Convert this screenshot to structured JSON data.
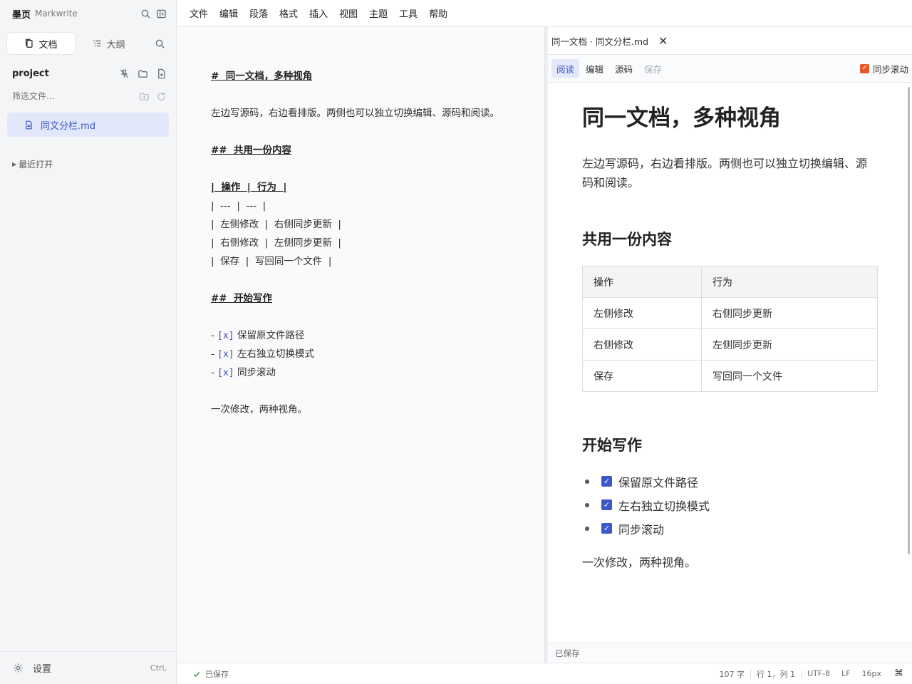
{
  "app": {
    "name": "墨页",
    "subtitle": "Markwrite"
  },
  "sidebar": {
    "tabs": [
      {
        "label": "文档"
      },
      {
        "label": "大纲"
      }
    ],
    "project": "project",
    "filter_placeholder": "筛选文件…",
    "files": [
      {
        "name": "同文分栏.md"
      }
    ],
    "recent_label": "最近打开",
    "settings_label": "设置",
    "settings_shortcut": "Ctrl,"
  },
  "menu": [
    "文件",
    "编辑",
    "段落",
    "格式",
    "插入",
    "视图",
    "主题",
    "工具",
    "帮助"
  ],
  "editor": {
    "lines": [
      {
        "text": "#  同一文档，多种视角",
        "heading": true
      },
      {
        "text": ""
      },
      {
        "text": "左边写源码，右边看排版。两侧也可以独立切换编辑、源码和阅读。"
      },
      {
        "text": ""
      },
      {
        "text": "##  共用一份内容",
        "heading": true
      },
      {
        "text": ""
      },
      {
        "text": "|  操作  |  行为  |",
        "heading": true
      },
      {
        "text": "|  ---  |  ---  |"
      },
      {
        "text": "|  左侧修改  |  右侧同步更新  |"
      },
      {
        "text": "|  右侧修改  |  左侧同步更新  |"
      },
      {
        "text": "|  保存  |  写回同一个文件  |"
      },
      {
        "text": ""
      },
      {
        "text": "##  开始写作",
        "heading": true
      },
      {
        "text": ""
      },
      {
        "text": "保留原文件路径",
        "task": true
      },
      {
        "text": "左右独立切换模式",
        "task": true
      },
      {
        "text": "同步滚动",
        "task": true
      },
      {
        "text": ""
      },
      {
        "text": "一次修改，两种视角。"
      }
    ],
    "task_prefix": "- ",
    "task_marker": "[x]"
  },
  "preview": {
    "title": "同一文档 · 同文分栏.md",
    "close_glyph": "✕",
    "modes": [
      {
        "label": "阅读",
        "state": "active"
      },
      {
        "label": "编辑",
        "state": "normal"
      },
      {
        "label": "源码",
        "state": "normal"
      },
      {
        "label": "保存",
        "state": "disabled"
      }
    ],
    "sync_label": "同步滚动",
    "h1": "同一文档，多种视角",
    "intro": "左边写源码，右边看排版。两侧也可以独立切换编辑、源码和阅读。",
    "h2_shared": "共用一份内容",
    "table": {
      "headers": [
        "操作",
        "行为"
      ],
      "rows": [
        [
          "左侧修改",
          "右侧同步更新"
        ],
        [
          "右侧修改",
          "左侧同步更新"
        ],
        [
          "保存",
          "写回同一个文件"
        ]
      ]
    },
    "h2_start": "开始写作",
    "tasks": [
      "保留原文件路径",
      "左右独立切换模式",
      "同步滚动"
    ],
    "closing": "一次修改，两种视角。",
    "status": "已保存"
  },
  "statusbar": {
    "saved": "已保存",
    "word_count": "107 字",
    "position": "行 1，列 1",
    "encoding": "UTF-8",
    "line_ending": "LF",
    "font_size": "16px",
    "cmd_glyph": "⌘"
  },
  "colors": {
    "accent": "#3b57c8",
    "sync_checkbox": "#e8572a",
    "sidebar_bg": "#f4f5f7"
  }
}
